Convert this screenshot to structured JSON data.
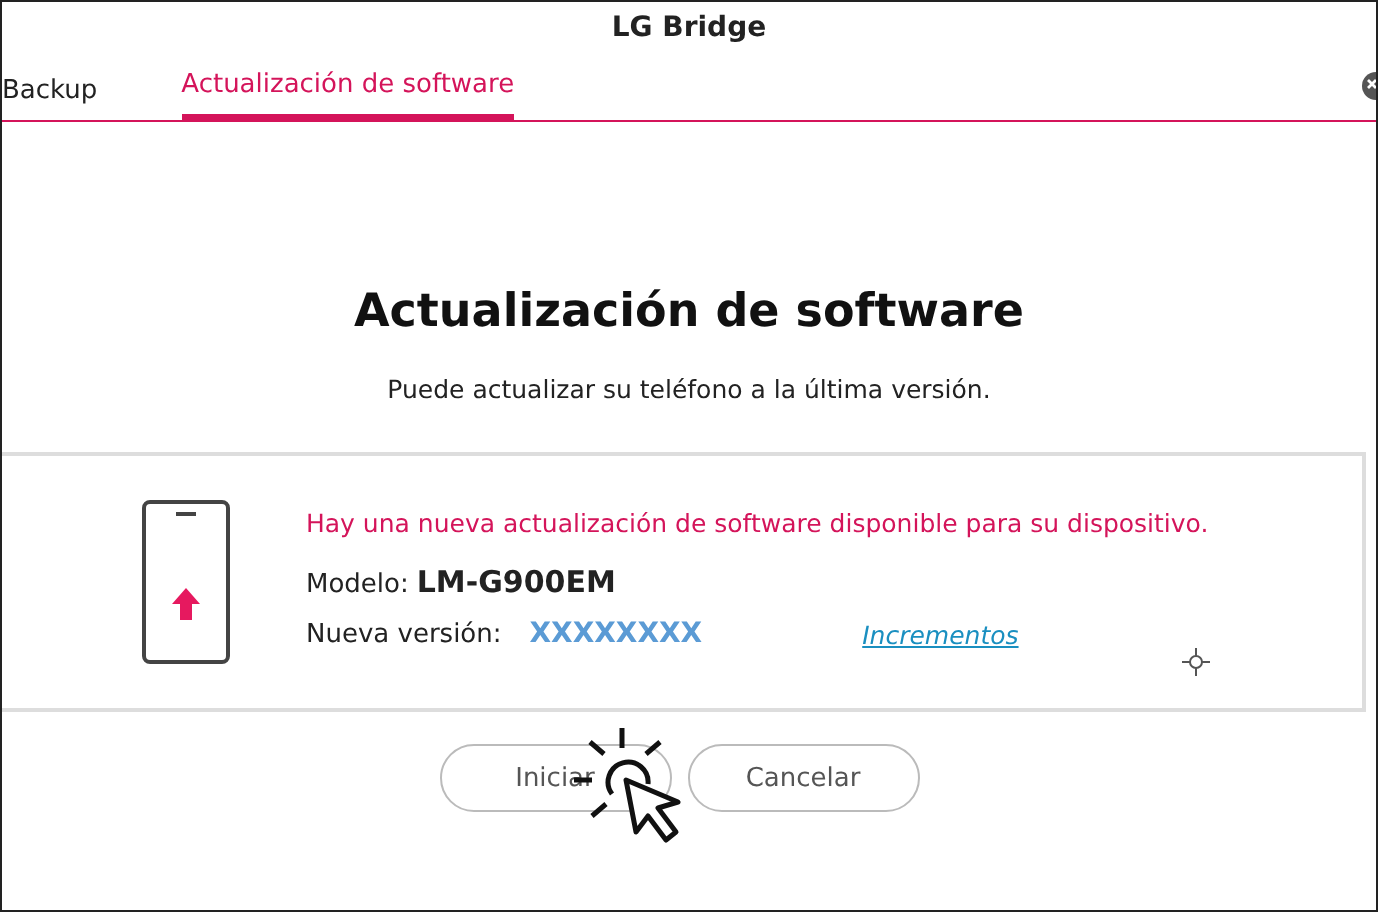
{
  "window": {
    "title": "LG Bridge"
  },
  "tabs": [
    {
      "label": "Backup",
      "selected": false
    },
    {
      "label": "Actualización de software",
      "selected": true
    }
  ],
  "heading": "Actualización de software",
  "subtitle": "Puede actualizar su teléfono a la última versión.",
  "update": {
    "message": "Hay una nueva actualización de software disponible para su dispositivo.",
    "model_label": "Modelo:",
    "model": "LM-G900EM",
    "version_label": "Nueva versión:",
    "version": "XXXXXXXX",
    "link": "Incrementos"
  },
  "buttons": [
    {
      "label": "Iniciar"
    },
    {
      "label": "Cancelar"
    }
  ]
}
